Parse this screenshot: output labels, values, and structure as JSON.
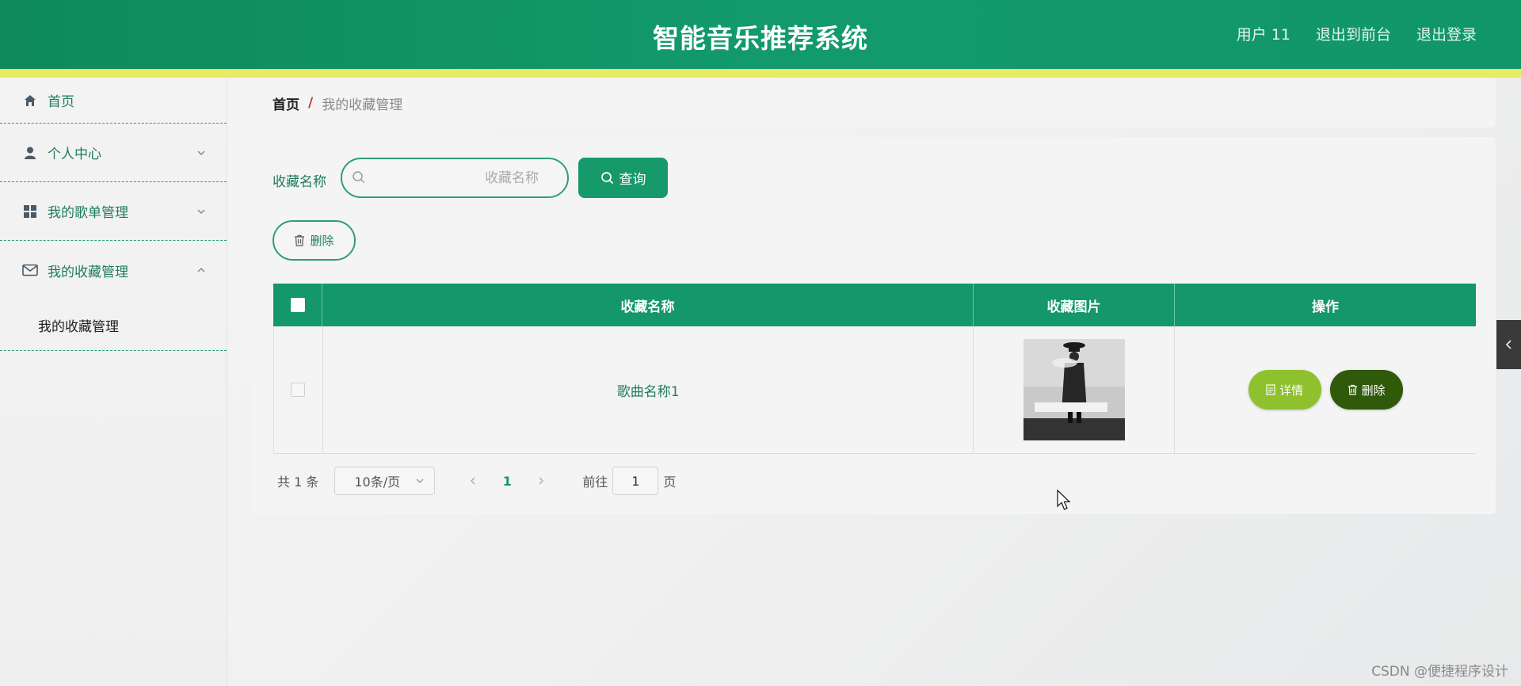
{
  "header": {
    "title": "智能音乐推荐系统",
    "user_label": "用户 11",
    "front_label": "退出到前台",
    "logout_label": "退出登录"
  },
  "sidebar": {
    "items": [
      {
        "label": "首页",
        "icon": "home-icon"
      },
      {
        "label": "个人中心",
        "icon": "user-icon"
      },
      {
        "label": "我的歌单管理",
        "icon": "grid-icon"
      },
      {
        "label": "我的收藏管理",
        "icon": "mail-icon"
      }
    ],
    "submenu_label": "我的收藏管理"
  },
  "breadcrumb": {
    "home": "首页",
    "sep": "/",
    "current": "我的收藏管理"
  },
  "search": {
    "label": "收藏名称",
    "placeholder": "收藏名称",
    "query_label": "查询"
  },
  "bulk_delete_label": "删除",
  "table": {
    "headers": [
      "收藏名称",
      "收藏图片",
      "操作"
    ],
    "rows": [
      {
        "name": "歌曲名称1",
        "detail_label": "详情",
        "delete_label": "删除"
      }
    ]
  },
  "pagination": {
    "total": "共 1 条",
    "page_size": "10条/页",
    "current_page": "1",
    "goto_label": "前往",
    "goto_value": "1",
    "page_unit": "页"
  },
  "watermark": "CSDN @便捷程序设计",
  "colors": {
    "primary": "#14976a",
    "stripe": "#e7ec62",
    "detail": "#8ec12d",
    "delete": "#2f5a0a"
  }
}
